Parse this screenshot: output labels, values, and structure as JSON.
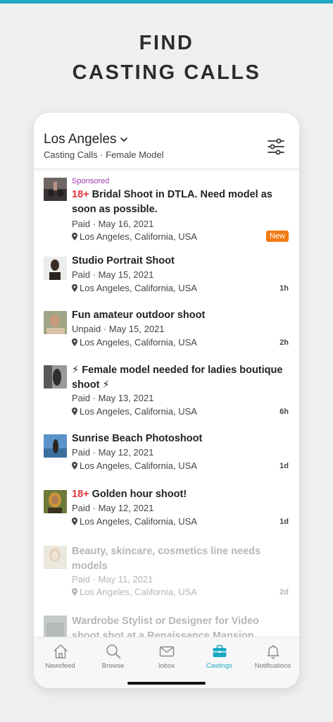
{
  "promo": {
    "line1": "FIND",
    "line2": "CASTING CALLS"
  },
  "header": {
    "location": "Los Angeles",
    "subtitle": "Casting Calls · Female Model"
  },
  "colors": {
    "accent": "#1aa9c4",
    "sponsored": "#a03bb0",
    "adult_tag": "#e0323c",
    "new_badge": "#f27a12"
  },
  "feed": [
    {
      "sponsored": "Sponsored",
      "tag": "18+",
      "title": " Bridal Shoot in DTLA. Need model as soon as possible.",
      "meta": "Paid · May 16, 2021",
      "location": "Los Angeles, California, USA",
      "badge": "New"
    },
    {
      "title": "Studio Portrait Shoot",
      "meta": "Paid · May 15, 2021",
      "location": "Los Angeles, California, USA",
      "age": "1h"
    },
    {
      "title": "Fun amateur outdoor shoot",
      "meta": "Unpaid · May 15, 2021",
      "location": "Los Angeles, California, USA",
      "age": "2h"
    },
    {
      "title": "⚡ Female model needed for ladies boutique shoot ⚡",
      "meta": "Paid · May 13, 2021",
      "location": "Los Angeles, California, USA",
      "age": "6h"
    },
    {
      "title": "Sunrise Beach Photoshoot",
      "meta": "Paid · May 12, 2021",
      "location": "Los Angeles, California, USA",
      "age": "1d"
    },
    {
      "tag": "18+",
      "title": " Golden hour shoot!",
      "meta": "Paid · May 12, 2021",
      "location": "Los Angeles, California, USA",
      "age": "1d"
    },
    {
      "title": "Beauty, skincare, cosmetics line needs models",
      "meta": "Paid · May 11, 2021",
      "location": "Los Angeles, California, USA",
      "age": "2d"
    },
    {
      "title": "Wardrobe Stylist or Designer for Video shoot shot at a Renaissance Mansion"
    }
  ],
  "tabs": [
    {
      "label": "Newsfeed",
      "icon": "house-icon"
    },
    {
      "label": "Browse",
      "icon": "magnifier-icon"
    },
    {
      "label": "Inbox",
      "icon": "envelope-icon"
    },
    {
      "label": "Castings",
      "icon": "briefcase-icon",
      "active": true
    },
    {
      "label": "Notifications",
      "icon": "bell-icon"
    }
  ]
}
